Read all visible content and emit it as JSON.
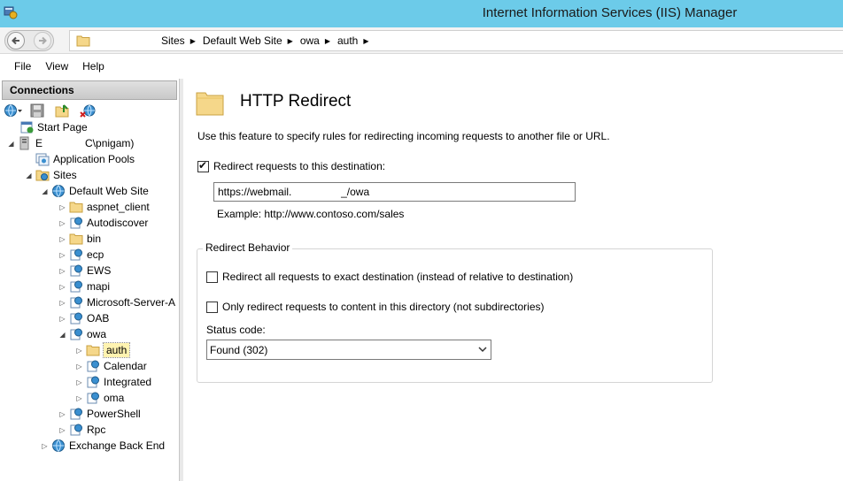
{
  "window": {
    "title": "Internet Information Services (IIS) Manager"
  },
  "address_bar": {
    "crumbs": [
      "Sites",
      "Default Web Site",
      "owa",
      "auth"
    ]
  },
  "menu": {
    "items": [
      "File",
      "View",
      "Help"
    ]
  },
  "connections": {
    "header": "Connections",
    "tree": {
      "start_page": "Start Page",
      "server_prefix": "E",
      "server_suffix": "C\\pnigam)",
      "app_pools": "Application Pools",
      "sites": "Sites",
      "default_web_site": "Default Web Site",
      "children": [
        "aspnet_client",
        "Autodiscover",
        "bin",
        "ecp",
        "EWS",
        "mapi",
        "Microsoft-Server-A",
        "OAB",
        "owa"
      ],
      "owa_children": [
        "auth",
        "Calendar",
        "Integrated",
        "oma"
      ],
      "after_owa": [
        "PowerShell",
        "Rpc"
      ],
      "exchange_back_end": "Exchange Back End"
    }
  },
  "feature": {
    "title": "HTTP Redirect",
    "description": "Use this feature to specify rules for redirecting incoming requests to another file or URL.",
    "redirect_checkbox_label": "Redirect requests to this destination:",
    "redirect_checked": true,
    "destination_value": "https://webmail.                 _/owa",
    "example": "Example: http://www.contoso.com/sales",
    "behavior_group": "Redirect Behavior",
    "exact_destination_label": "Redirect all requests to exact destination (instead of relative to destination)",
    "exact_destination_checked": false,
    "only_directory_label": "Only redirect requests to content in this directory (not subdirectories)",
    "only_directory_checked": false,
    "status_code_label": "Status code:",
    "status_code_value": "Found (302)"
  },
  "colors": {
    "titlebar": "#6ccbe9",
    "selection": "#fff3b0"
  }
}
